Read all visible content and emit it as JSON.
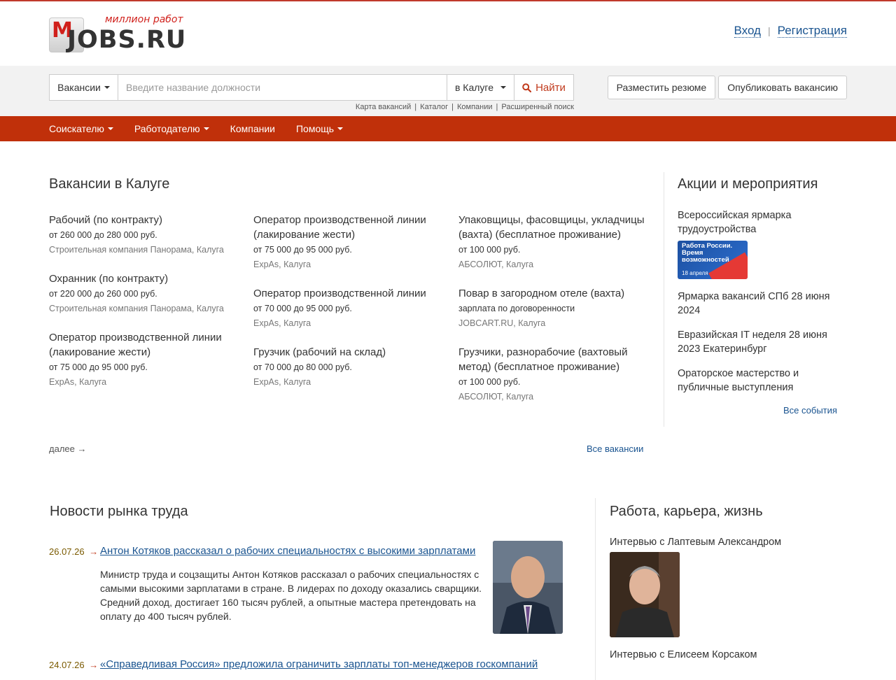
{
  "header": {
    "logo_tagline": "миллион работ",
    "logo_letter": "M",
    "logo_word": "JOBS.RU",
    "login": "Вход",
    "auth_sep": "|",
    "register": "Регистрация"
  },
  "search": {
    "type_label": "Вакансии",
    "placeholder": "Введите название должности",
    "city_label": "в Калуге",
    "find_label": "Найти",
    "sublinks": [
      "Карта вакансий",
      "Каталог",
      "Компании",
      "Расширенный поиск"
    ],
    "sublink_sep": "|",
    "post_resume": "Разместить резюме",
    "post_vacancy": "Опубликовать вакансию"
  },
  "nav": {
    "items": [
      {
        "label": "Соискателю",
        "dropdown": true
      },
      {
        "label": "Работодателю",
        "dropdown": true
      },
      {
        "label": "Компании",
        "dropdown": false
      },
      {
        "label": "Помощь",
        "dropdown": true
      }
    ]
  },
  "vacancies": {
    "title": "Вакансии в Калуге",
    "columns": [
      [
        {
          "title": "Рабочий (по контракту)",
          "salary": "от 260 000 до 280 000 руб.",
          "company": "Строительная компания Панорама, Калуга"
        },
        {
          "title": "Охранник (по контракту)",
          "salary": "от 220 000 до 260 000 руб.",
          "company": "Строительная компания Панорама, Калуга"
        },
        {
          "title": "Оператор производственной линии (лакирование жести)",
          "salary": "от 75 000 до 95 000 руб.",
          "company": "ExpAs, Калуга"
        }
      ],
      [
        {
          "title": "Оператор производственной линии (лакирование жести)",
          "salary": "от 75 000 до 95 000 руб.",
          "company": "ExpAs, Калуга"
        },
        {
          "title": "Оператор производственной линии",
          "salary": "от 70 000 до 95 000 руб.",
          "company": "ExpAs, Калуга"
        },
        {
          "title": "Грузчик (рабочий на склад)",
          "salary": "от 70 000 до 80 000 руб.",
          "company": "ExpAs, Калуга"
        }
      ],
      [
        {
          "title": "Упаковщицы, фасовщицы, укладчицы (вахта) (бесплатное проживание)",
          "salary": "от 100 000 руб.",
          "company": "АБСОЛЮТ, Калуга"
        },
        {
          "title": "Повар в загородном отеле (вахта)",
          "salary": "зарплата по договоренности",
          "company": "JOBCART.RU, Калуга"
        },
        {
          "title": "Грузчики, разнорабочие (вахтовый метод) (бесплатное проживание)",
          "salary": "от 100 000 руб.",
          "company": "АБСОЛЮТ, Калуга"
        }
      ]
    ],
    "more": "далее →",
    "all": "Все вакансии"
  },
  "events": {
    "title": "Акции и мероприятия",
    "items": [
      "Всероссийская ярмарка трудоустройства",
      "Ярмарка вакансий СПб 28 июня 2024",
      "Евразийская IT неделя 28 июня 2023 Екатеринбург",
      "Ораторское мастерство и публичные выступления"
    ],
    "banner_text": "Работа России. Время возможностей",
    "banner_date": "18 апреля",
    "all": "Все события"
  },
  "news": {
    "title": "Новости рынка труда",
    "items": [
      {
        "date": "26.07.26",
        "arrow": "→",
        "title": "Антон Котяков рассказал о рабочих специальностях с высокими зарплатами",
        "text": "Министр труда и соцзащиты Антон Котяков рассказал о рабочих специальностях с самыми высокими зарплатами в стране. В лидерах по доходу оказались сварщики. Средний доход, достигает 160 тысяч рублей, а опытные мастера претендовать на оплату до 400 тысяч рублей."
      },
      {
        "date": "24.07.26",
        "arrow": "→",
        "title": "«Справедливая Россия» предложила ограничить зарплаты топ-менеджеров госкомпаний",
        "text": ""
      }
    ]
  },
  "career": {
    "title": "Работа, карьера, жизнь",
    "items": [
      "Интервью с Лаптевым Александром",
      "Интервью с Елисеем Корсаком"
    ]
  }
}
